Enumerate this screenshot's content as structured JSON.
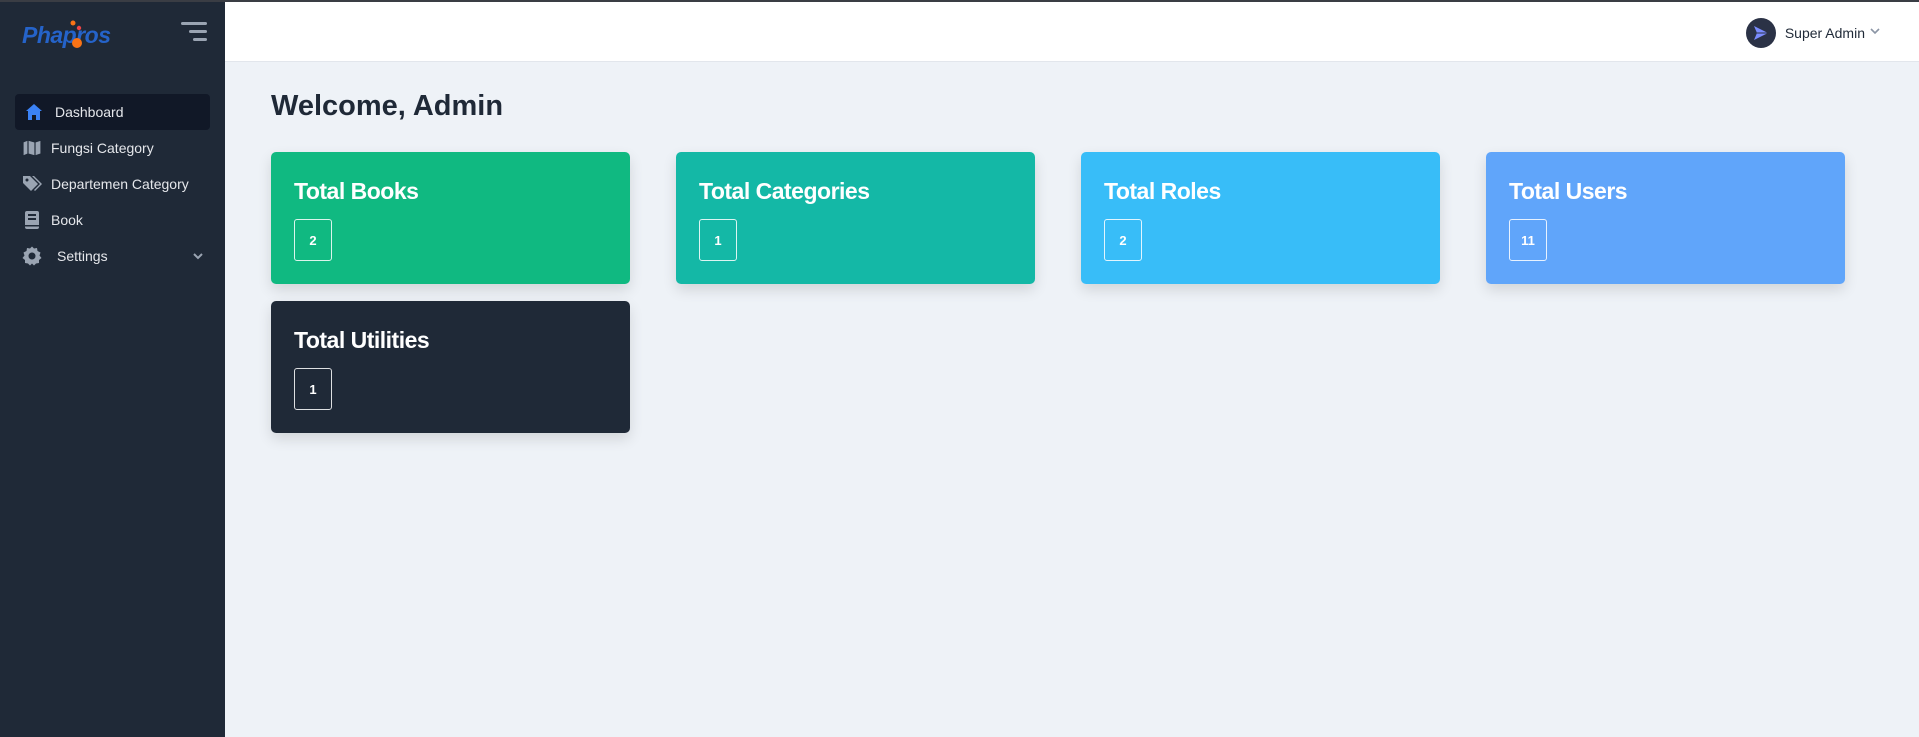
{
  "app": {
    "logo_text": "Phapros"
  },
  "sidebar": {
    "items": [
      {
        "label": "Dashboard",
        "icon": "home-icon",
        "active": true
      },
      {
        "label": "Fungsi Category",
        "icon": "map-icon"
      },
      {
        "label": "Departemen Category",
        "icon": "tags-icon"
      },
      {
        "label": "Book",
        "icon": "book-icon"
      },
      {
        "label": "Settings",
        "icon": "gear-icon",
        "has_submenu": true
      }
    ]
  },
  "header": {
    "user_name": "Super Admin",
    "avatar_icon": "paper-plane-icon"
  },
  "main": {
    "welcome": "Welcome, Admin",
    "cards": [
      {
        "title": "Total Books",
        "value": "2",
        "color": "#10b981"
      },
      {
        "title": "Total Categories",
        "value": "1",
        "color": "#14b8a6"
      },
      {
        "title": "Total Roles",
        "value": "2",
        "color": "#38bdf8"
      },
      {
        "title": "Total Users",
        "value": "11",
        "color": "#60a5fa"
      },
      {
        "title": "Total Utilities",
        "value": "1",
        "color": "#1f2937"
      }
    ]
  },
  "colors": {
    "sidebar_bg": "#1f2937",
    "active_item_bg": "#111827",
    "accent": "#3b82f6",
    "page_bg": "#eef2f7"
  }
}
